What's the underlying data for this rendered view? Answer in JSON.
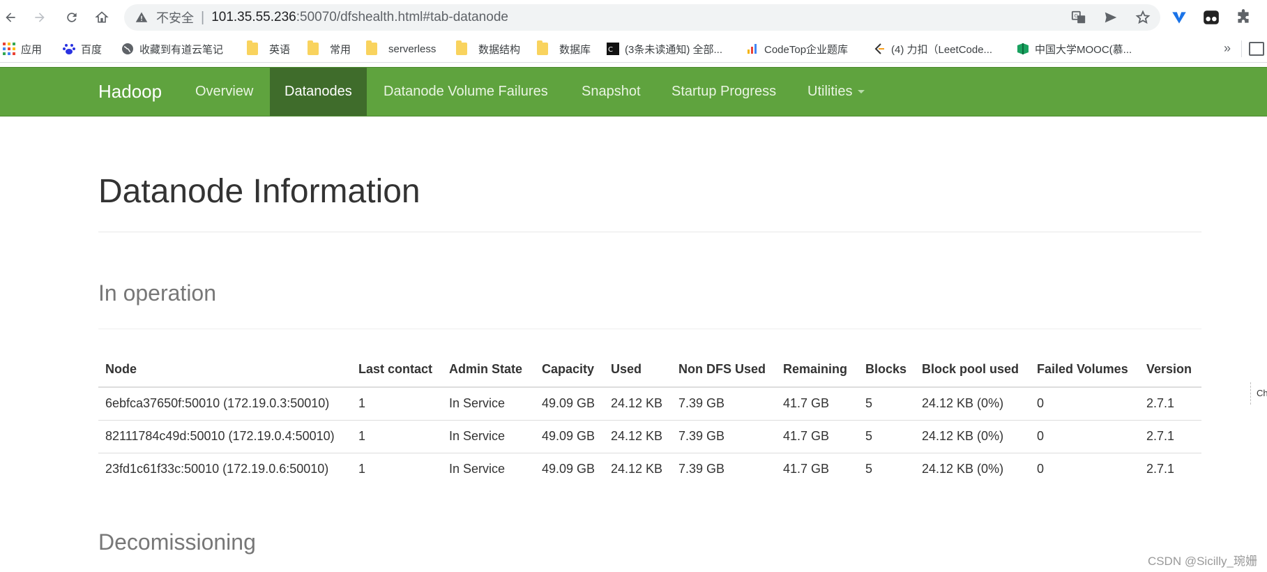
{
  "browser": {
    "insecure_label": "不安全",
    "url_host": "101.35.55.236",
    "url_rest": ":50070/dfshealth.html#tab-datanode"
  },
  "bookmarks": [
    {
      "label": "应用",
      "icon": "apps-grid-icon"
    },
    {
      "label": "百度",
      "icon": "baidu-paw-icon"
    },
    {
      "label": "收藏到有道云笔记",
      "icon": "globe-icon"
    },
    {
      "label": "英语",
      "icon": "folder-icon"
    },
    {
      "label": "常用",
      "icon": "folder-icon"
    },
    {
      "label": "serverless",
      "icon": "folder-icon"
    },
    {
      "label": "数据结构",
      "icon": "folder-icon"
    },
    {
      "label": "数据库",
      "icon": "folder-icon"
    },
    {
      "label": "(3条未读通知) 全部...",
      "icon": "csdn-icon"
    },
    {
      "label": "CodeTop企业题库",
      "icon": "bar-chart-icon"
    },
    {
      "label": "(4) 力扣（LeetCode...",
      "icon": "leetcode-icon"
    },
    {
      "label": "中国大学MOOC(慕...",
      "icon": "mooc-icon"
    }
  ],
  "bookmarks_more": "»",
  "navbar": {
    "brand": "Hadoop",
    "items": [
      "Overview",
      "Datanodes",
      "Datanode Volume Failures",
      "Snapshot",
      "Startup Progress",
      "Utilities"
    ],
    "active": "Datanodes"
  },
  "page": {
    "title": "Datanode Information",
    "section_in_operation": "In operation",
    "section_decommissioning": "Decomissioning"
  },
  "table": {
    "headers": [
      "Node",
      "Last contact",
      "Admin State",
      "Capacity",
      "Used",
      "Non DFS Used",
      "Remaining",
      "Blocks",
      "Block pool used",
      "Failed Volumes",
      "Version"
    ],
    "rows": [
      [
        "6ebfca37650f:50010 (172.19.0.3:50010)",
        "1",
        "In Service",
        "49.09 GB",
        "24.12 KB",
        "7.39 GB",
        "41.7 GB",
        "5",
        "24.12 KB (0%)",
        "0",
        "2.7.1"
      ],
      [
        "82111784c49d:50010 (172.19.0.4:50010)",
        "1",
        "In Service",
        "49.09 GB",
        "24.12 KB",
        "7.39 GB",
        "41.7 GB",
        "5",
        "24.12 KB (0%)",
        "0",
        "2.7.1"
      ],
      [
        "23fd1c61f33c:50010 (172.19.0.6:50010)",
        "1",
        "In Service",
        "49.09 GB",
        "24.12 KB",
        "7.39 GB",
        "41.7 GB",
        "5",
        "24.12 KB (0%)",
        "0",
        "2.7.1"
      ]
    ]
  },
  "side_tab": "Ch",
  "watermark": "CSDN @Sicilly_琬姗",
  "colors": {
    "navbar": "#5fa33e",
    "navbar_active": "#3f6c2b"
  }
}
